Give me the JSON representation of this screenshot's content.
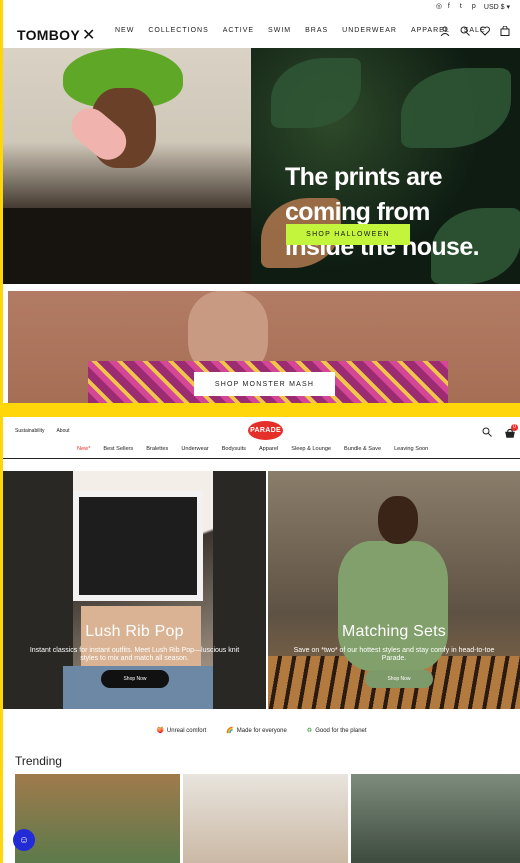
{
  "tomboy": {
    "currency": "USD $",
    "brand": "TOMBOY",
    "brand_mark": "✕",
    "nav": [
      "NEW",
      "COLLECTIONS",
      "ACTIVE",
      "SWIM",
      "BRAS",
      "UNDERWEAR",
      "APPAREL",
      "SALE"
    ],
    "hero1": {
      "headline_lines": [
        "The prints are",
        "coming from",
        "inside the house."
      ],
      "cta": "SHOP HALLOWEEN",
      "cta_color": "#c3f53c"
    },
    "hero2": {
      "cta": "SHOP MONSTER MASH"
    }
  },
  "parade": {
    "top_links": [
      "Sustainability",
      "About"
    ],
    "logo": "PARADE",
    "brand_color": "#e5302a",
    "cart_count": "0",
    "nav": [
      "New*",
      "Best Sellers",
      "Bralettes",
      "Underwear",
      "Bodysuits",
      "Apparel",
      "Sleep & Lounge",
      "Bundle & Save",
      "Leaving Soon"
    ],
    "hero_left": {
      "title": "Lush Rib Pop",
      "text": "Instant classics for instant outfits. Meet Lush Rib Pop—luscious knit styles to mix and match all season.",
      "cta": "Shop Now"
    },
    "hero_right": {
      "title": "Matching Sets",
      "text": "Save on *two* of our hottest styles and stay comfy in head-to-toe Parade.",
      "cta": "Shop Now"
    },
    "values": [
      {
        "icon": "peach-icon",
        "label": "Unreal comfort"
      },
      {
        "icon": "rainbow-icon",
        "label": "Made for everyone"
      },
      {
        "icon": "recycle-icon",
        "label": "Good for the planet"
      }
    ],
    "trending_title": "Trending"
  }
}
